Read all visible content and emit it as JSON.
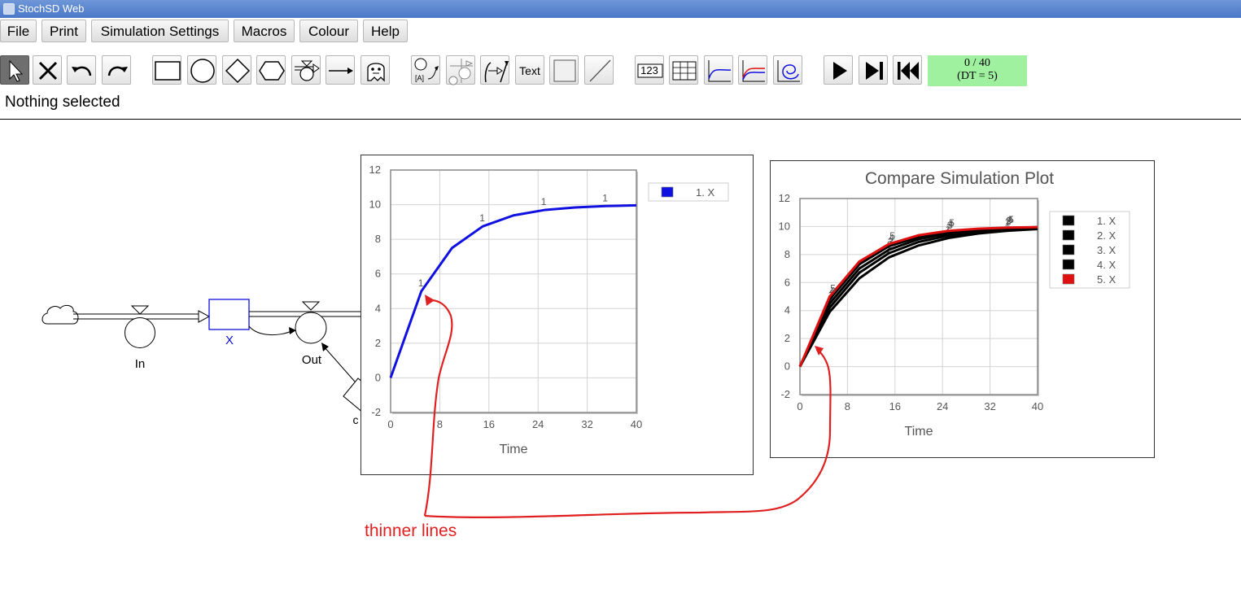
{
  "window": {
    "title": "StochSD Web"
  },
  "menu": [
    "File",
    "Print",
    "Simulation Settings",
    "Macros",
    "Colour",
    "Help"
  ],
  "toolbar": {
    "text_tool_label": "Text",
    "number_tool_label": "123",
    "time_display": {
      "line1": "0 / 40",
      "line2": "(DT = 5)"
    }
  },
  "status": "Nothing selected",
  "diagram": {
    "stock_label": "X",
    "flow_in_label": "In",
    "flow_out_label": "Out",
    "hidden_label_fragment": "c"
  },
  "colors": {
    "accent_blue": "#1010e0",
    "run_red": "#e01010",
    "annotation_red": "#e02020",
    "time_box_green": "#9ff09f"
  },
  "chart_data": [
    {
      "type": "line",
      "title": "",
      "xlabel": "Time",
      "ylabel": "",
      "xlim": [
        0,
        40
      ],
      "ylim": [
        -2,
        12
      ],
      "xticks": [
        0,
        8,
        16,
        24,
        32,
        40
      ],
      "yticks": [
        -2,
        0,
        2,
        4,
        6,
        8,
        10,
        12
      ],
      "grid": true,
      "legend_position": "top-right",
      "series": [
        {
          "name": "1. X",
          "color": "#1010e0",
          "marker_label": "1",
          "x": [
            0,
            5,
            10,
            15,
            20,
            25,
            30,
            35,
            40
          ],
          "y": [
            0,
            5,
            7.5,
            8.75,
            9.38,
            9.69,
            9.84,
            9.92,
            9.96
          ]
        }
      ]
    },
    {
      "type": "line",
      "title": "Compare Simulation Plot",
      "xlabel": "Time",
      "ylabel": "",
      "xlim": [
        0,
        40
      ],
      "ylim": [
        -2,
        12
      ],
      "xticks": [
        0,
        8,
        16,
        24,
        32,
        40
      ],
      "yticks": [
        -2,
        0,
        2,
        4,
        6,
        8,
        10,
        12
      ],
      "grid": true,
      "legend_position": "top-right",
      "series": [
        {
          "name": "1. X",
          "color": "#000000",
          "marker_label": "1",
          "x": [
            0,
            5,
            10,
            15,
            20,
            25,
            30,
            35,
            40
          ],
          "y": [
            0,
            3.9,
            6.3,
            7.8,
            8.65,
            9.18,
            9.5,
            9.7,
            9.82
          ]
        },
        {
          "name": "2. X",
          "color": "#000000",
          "marker_label": "2",
          "x": [
            0,
            5,
            10,
            15,
            20,
            25,
            30,
            35,
            40
          ],
          "y": [
            0,
            4.2,
            6.7,
            8.1,
            8.9,
            9.35,
            9.62,
            9.78,
            9.87
          ]
        },
        {
          "name": "3. X",
          "color": "#000000",
          "marker_label": "3",
          "x": [
            0,
            5,
            10,
            15,
            20,
            25,
            30,
            35,
            40
          ],
          "y": [
            0,
            4.5,
            7.0,
            8.35,
            9.1,
            9.5,
            9.72,
            9.85,
            9.92
          ]
        },
        {
          "name": "4. X",
          "color": "#000000",
          "marker_label": "4",
          "x": [
            0,
            5,
            10,
            15,
            20,
            25,
            30,
            35,
            40
          ],
          "y": [
            0,
            4.8,
            7.3,
            8.6,
            9.25,
            9.6,
            9.8,
            9.9,
            9.95
          ]
        },
        {
          "name": "5. X",
          "color": "#e01010",
          "marker_label": "5",
          "x": [
            0,
            5,
            10,
            15,
            20,
            25,
            30,
            35,
            40
          ],
          "y": [
            0,
            5,
            7.5,
            8.75,
            9.38,
            9.69,
            9.84,
            9.92,
            9.96
          ]
        }
      ]
    }
  ],
  "annotation": {
    "text": "thinner lines"
  }
}
